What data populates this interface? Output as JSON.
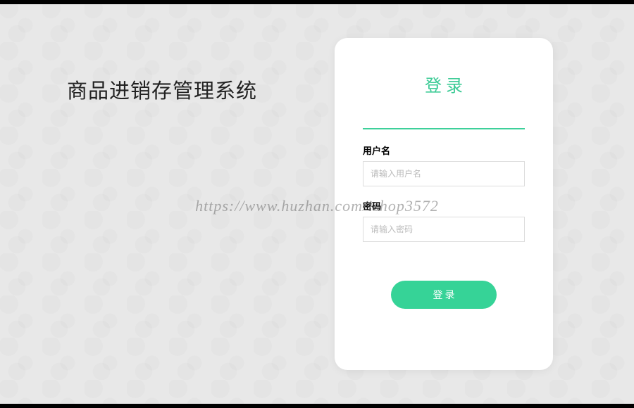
{
  "system_title": "商品进销存管理系统",
  "login_card": {
    "title": "登录",
    "username": {
      "label": "用户名",
      "placeholder": "请输入用户名",
      "value": ""
    },
    "password": {
      "label": "密码",
      "placeholder": "请输入密码",
      "value": ""
    },
    "submit_label": "登录"
  },
  "watermark_text": "https://www.huzhan.com/ishop3572",
  "colors": {
    "accent": "#3dcb96",
    "button": "#36d397"
  }
}
